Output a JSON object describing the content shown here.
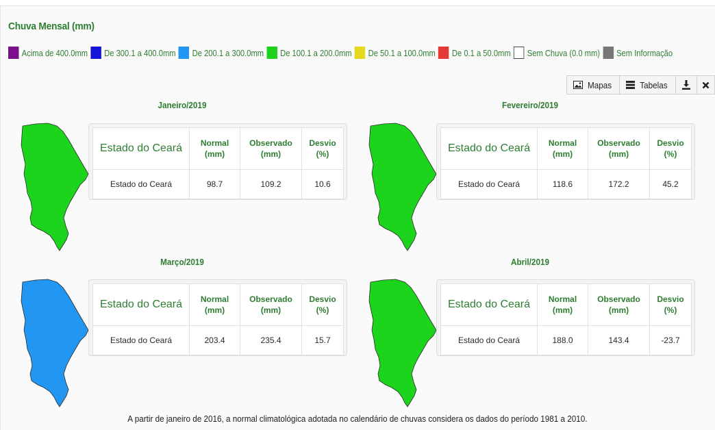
{
  "header": {
    "title": "Chuva Mensal (mm)"
  },
  "legend": [
    {
      "label": "Acima de 400.0mm",
      "color": "#7b0e8a"
    },
    {
      "label": "De 300.1 a 400.0mm",
      "color": "#1414d8"
    },
    {
      "label": "De 200.1 a 300.0mm",
      "color": "#2196f3"
    },
    {
      "label": "De 100.1 a 200.0mm",
      "color": "#1cd41c"
    },
    {
      "label": "De 50.1 a 100.0mm",
      "color": "#e6d81e"
    },
    {
      "label": "De 0.1 a 50.0mm",
      "color": "#e53935"
    },
    {
      "label": "Sem Chuva (0.0 mm)",
      "color": "#ffffff"
    },
    {
      "label": "Sem Informação",
      "color": "#777777"
    }
  ],
  "toolbar": {
    "maps_label": "Mapas",
    "maps_icon": "image-icon",
    "tables_label": "Tabelas",
    "tables_icon": "table-icon",
    "download_icon": "download-icon",
    "close_icon": "close-icon"
  },
  "table_headers": {
    "region": "Estado do Ceará",
    "normal_line1": "Normal",
    "normal_line2": "(mm)",
    "observed_line1": "Observado",
    "observed_line2": "(mm)",
    "deviation_line1": "Desvio",
    "deviation_line2": "(%)"
  },
  "months": [
    {
      "title": "Janeiro/2019",
      "map_color": "#1cd41c",
      "row": {
        "region": "Estado do Ceará",
        "normal": "98.7",
        "observed": "109.2",
        "deviation": "10.6"
      }
    },
    {
      "title": "Fevereiro/2019",
      "map_color": "#1cd41c",
      "row": {
        "region": "Estado do Ceará",
        "normal": "118.6",
        "observed": "172.2",
        "deviation": "45.2"
      }
    },
    {
      "title": "Março/2019",
      "map_color": "#2196f3",
      "row": {
        "region": "Estado do Ceará",
        "normal": "203.4",
        "observed": "235.4",
        "deviation": "15.7"
      }
    },
    {
      "title": "Abril/2019",
      "map_color": "#1cd41c",
      "row": {
        "region": "Estado do Ceará",
        "normal": "188.0",
        "observed": "143.4",
        "deviation": "-23.7"
      }
    }
  ],
  "footnote": "A partir de janeiro de 2016, a normal climatológica adotada no calendário de chuvas considera os dados do período 1981 a 2010."
}
